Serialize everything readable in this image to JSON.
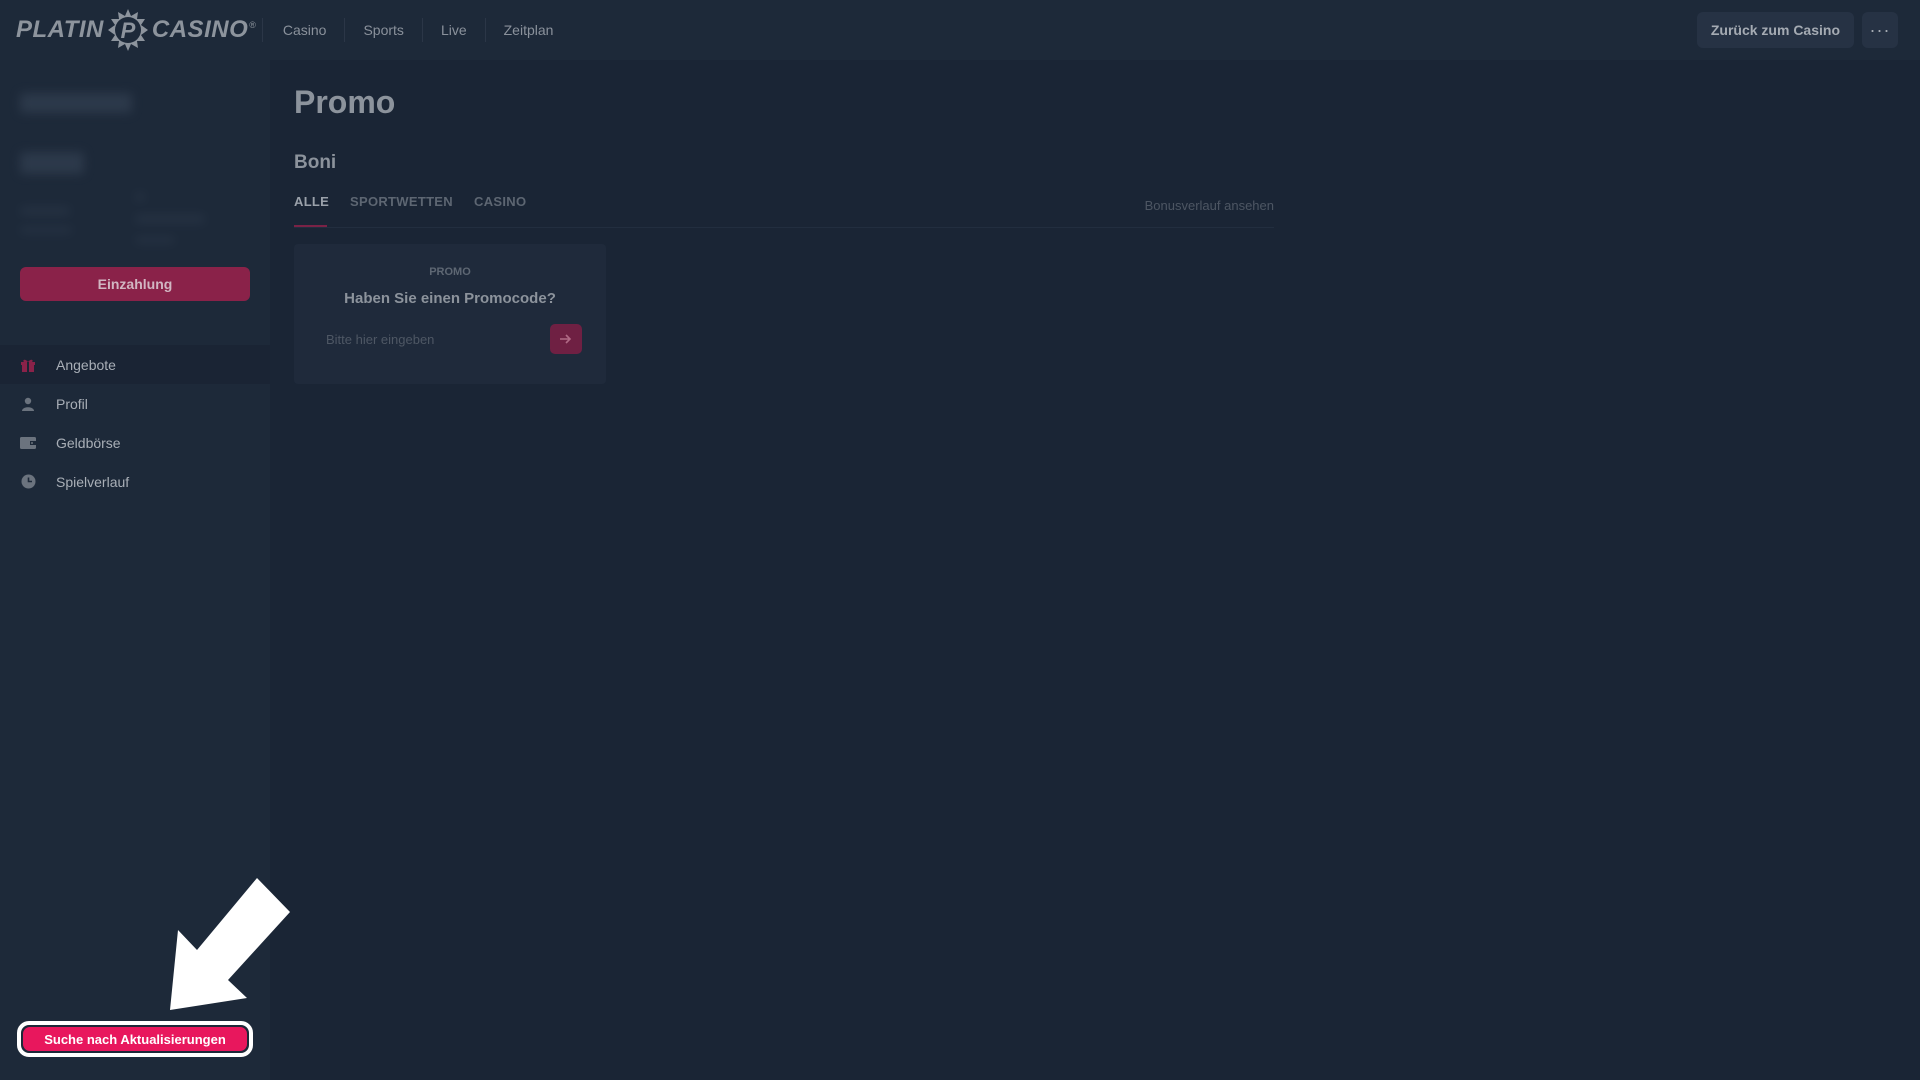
{
  "header": {
    "logo": {
      "left": "PLATIN",
      "right": "CASINO",
      "tm": "®"
    },
    "nav": [
      {
        "label": "Casino"
      },
      {
        "label": "Sports"
      },
      {
        "label": "Live"
      },
      {
        "label": "Zeitplan"
      }
    ],
    "back_label": "Zurück zum Casino",
    "more_label": "···"
  },
  "sidebar": {
    "deposit_label": "Einzahlung",
    "menu": [
      {
        "label": "Angebote",
        "icon": "gift-icon",
        "active": true
      },
      {
        "label": "Profil",
        "icon": "user-icon",
        "active": false
      },
      {
        "label": "Geldbörse",
        "icon": "wallet-icon",
        "active": false
      },
      {
        "label": "Spielverlauf",
        "icon": "clock-icon",
        "active": false
      }
    ],
    "update_label": "Suche nach Aktualisierungen"
  },
  "main": {
    "title": "Promo",
    "section_title": "Boni",
    "tabs": [
      {
        "label": "ALLE",
        "active": true
      },
      {
        "label": "SPORTWETTEN",
        "active": false
      },
      {
        "label": "CASINO",
        "active": false
      }
    ],
    "history_link": "Bonusverlauf ansehen",
    "promo_card": {
      "label": "PROMO",
      "question": "Haben Sie einen Promocode?",
      "input_placeholder": "Bitte hier eingeben"
    }
  },
  "colors": {
    "accent": "#e8175d",
    "background": "#1a2535",
    "panel": "#1d2939"
  }
}
